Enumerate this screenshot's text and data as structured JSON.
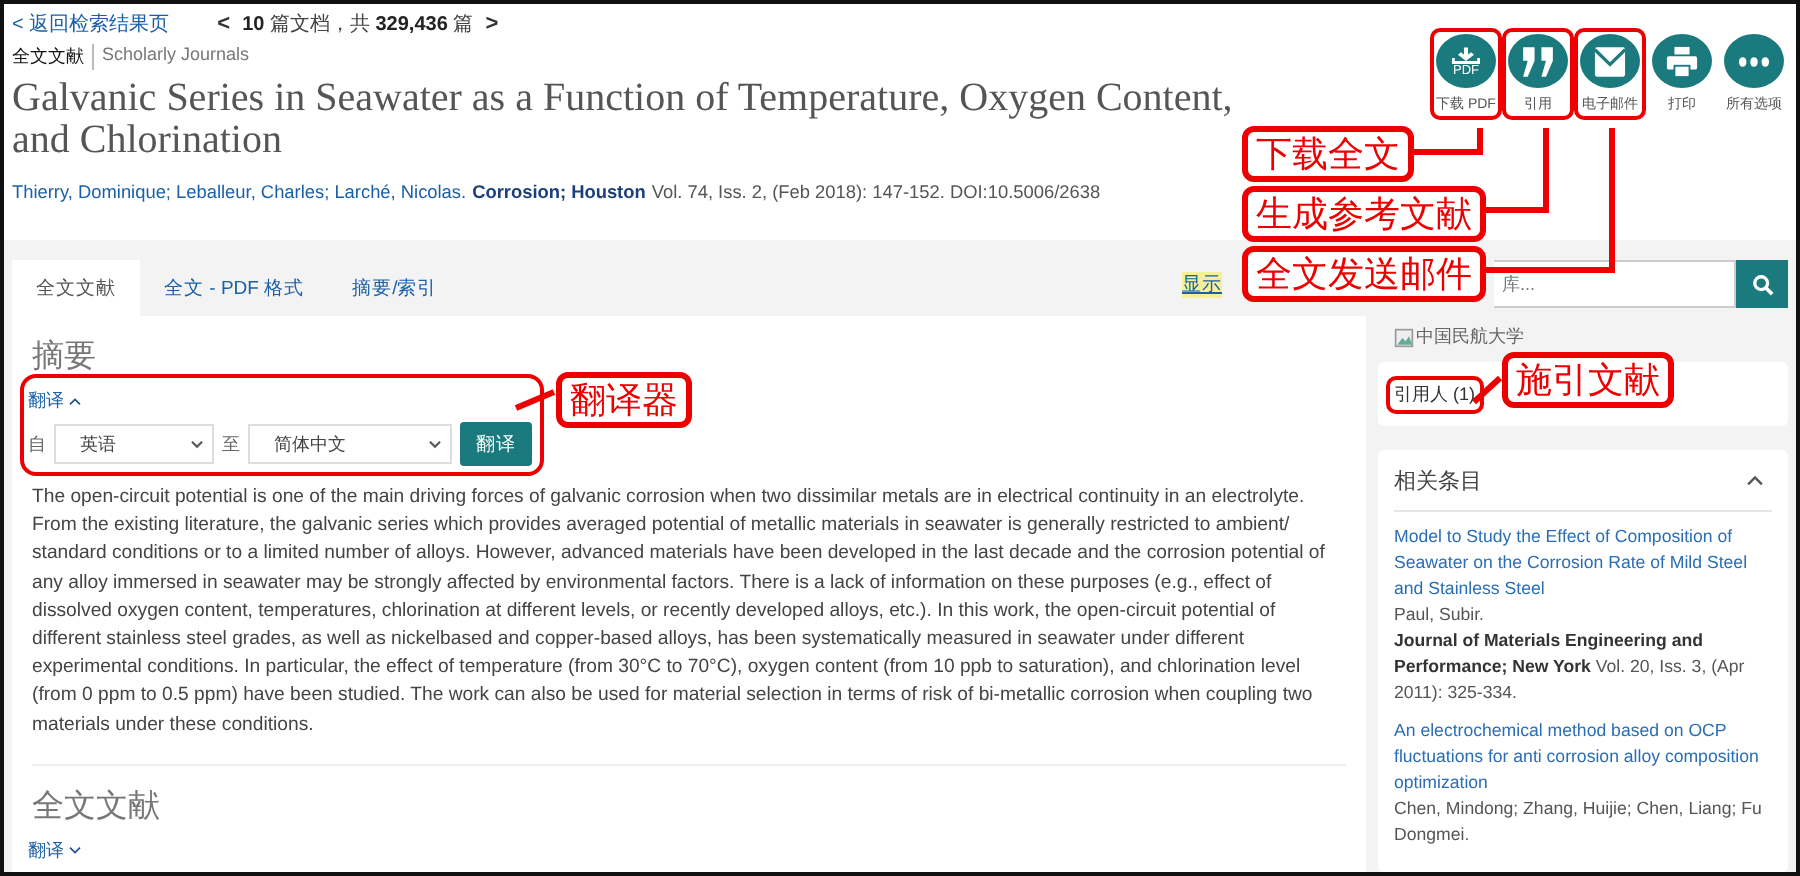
{
  "nav": {
    "back_link": "< 返回检索结果页",
    "prev": "<",
    "pager": "**10** 篇文档，共 **329,436** 篇",
    "next": ">"
  },
  "doc_type": "全文文献",
  "source_type": "Scholarly Journals",
  "title": "Galvanic Series in Seawater as a Function of Temperature, Oxygen Content, and Chlorination",
  "citation": {
    "authors": "Thierry, Dominique; Leballeur, Charles; Larché, Nicolas.",
    "source": "Corrosion; Houston",
    "details": "Vol. 74, Iss. 2,  (Feb 2018): 147-152. DOI:10.5006/2638"
  },
  "actions": [
    {
      "kind": "download",
      "badge": "PDF",
      "label": "下载 PDF",
      "annotated": true
    },
    {
      "kind": "quote",
      "label": "引用",
      "annotated": true
    },
    {
      "kind": "mail",
      "label": "电子邮件",
      "annotated": true
    },
    {
      "kind": "print",
      "label": "打印",
      "annotated": false
    },
    {
      "kind": "more",
      "label": "所有选项",
      "annotated": false
    }
  ],
  "tabs": [
    {
      "label": "全文文献",
      "selected": true
    },
    {
      "label": "全文 - PDF 格式",
      "selected": false
    },
    {
      "label": "摘要/索引",
      "selected": false
    }
  ],
  "highlight_link": "显示",
  "search": {
    "placeholder": "库..."
  },
  "abstract": {
    "heading": "摘要",
    "translate": {
      "label": "翻译",
      "expanded": true,
      "annotated": true,
      "from_label": "自",
      "from": "英语",
      "to_label": "至",
      "to": "简体中文",
      "button": "翻译"
    },
    "text": "The open-circuit potential is one of the main driving forces of galvanic corrosion when two dissimilar metals are in electrical continuity in an electrolyte. From the existing literature, the galvanic series which provides averaged potential of metallic materials in seawater is generally restricted to ambient/ standard conditions or to a limited number of alloys. However, advanced materials have been developed in the last decade and the corrosion potential of any alloy immersed in seawater may be strongly affected by environmental factors. There is a lack of information on these purposes (e.g., effect of dissolved oxygen content, temperatures, chlorination at different levels, or recently developed alloys, etc.). In this work, the open-circuit potential of different stainless steel grades, as well as nickelbased and copper-based alloys, has been systematically measured in seawater under different experimental conditions. In particular, the effect of temperature (from 30°C to 70°C), oxygen content (from 10 ppb to saturation), and chlorination level (from 0 ppm to 0.5 ppm) have been studied. The work can also be used for material selection in terms of risk of bi-metallic corrosion when coupling two materials under these conditions."
  },
  "fulltext": {
    "heading": "全文文献",
    "translate": {
      "label": "翻译",
      "expanded": false
    }
  },
  "sidebar": {
    "library_image": "中国民航大学",
    "cited_by": {
      "label": "引用人 (1)",
      "annotated": true
    },
    "related": {
      "title": "相关条目",
      "expanded": true,
      "items": [
        {
          "title": "Model to Study the Effect of Composition of Seawater on the Corrosion Rate of Mild Steel and Stainless Steel",
          "authors": "Paul, Subir.",
          "source": "Journal of Materials Engineering and Performance; New York",
          "details": "Vol. 20, Iss. 3,  (Apr 2011): 325-334."
        },
        {
          "title": "An electrochemical method based on OCP fluctuations for anti corrosion alloy composition optimization",
          "authors": "Chen, Mindong; Zhang, Huijie; Chen, Liang; Fu Dongmei."
        }
      ]
    }
  },
  "annotations": [
    {
      "text": "下载全文"
    },
    {
      "text": "生成参考文献"
    },
    {
      "text": "全文发送邮件"
    },
    {
      "text": "翻译器"
    },
    {
      "text": "施引文献"
    }
  ]
}
